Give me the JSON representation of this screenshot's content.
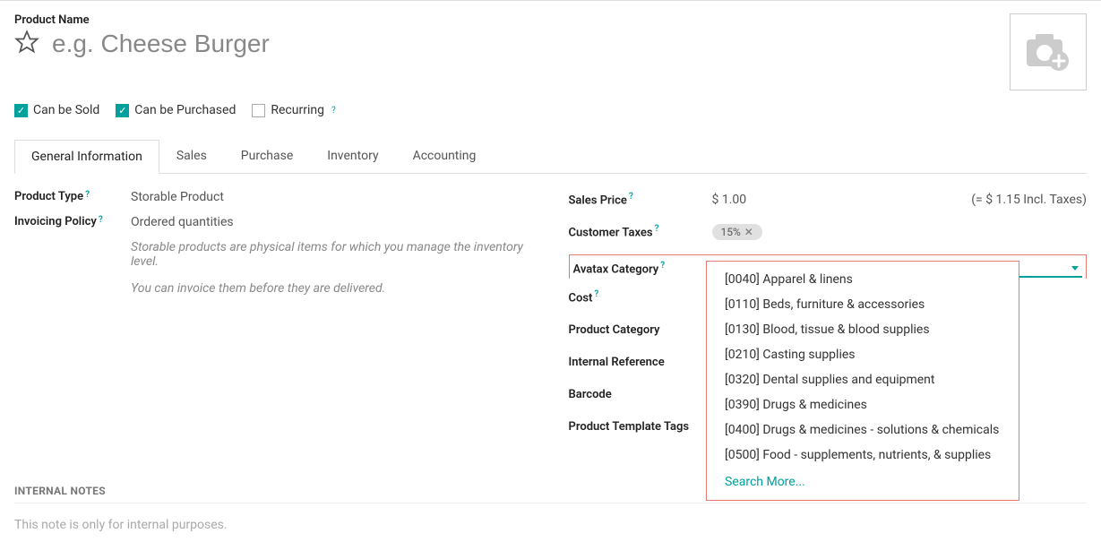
{
  "header": {
    "product_name_label": "Product Name",
    "placeholder": "e.g. Cheese Burger"
  },
  "checks": {
    "sold": "Can be Sold",
    "purchased": "Can be Purchased",
    "recurring": "Recurring"
  },
  "tabs": {
    "general": "General Information",
    "sales": "Sales",
    "purchase": "Purchase",
    "inventory": "Inventory",
    "accounting": "Accounting"
  },
  "left": {
    "product_type_label": "Product Type",
    "product_type_value": "Storable Product",
    "invoicing_label": "Invoicing Policy",
    "invoicing_value": "Ordered quantities",
    "desc1": "Storable products are physical items for which you manage the inventory level.",
    "desc2": "You can invoice them before they are delivered."
  },
  "right": {
    "sales_price_label": "Sales Price",
    "sales_price_value": "$ 1.00",
    "incl_taxes": "(= $ 1.15 Incl. Taxes)",
    "customer_taxes_label": "Customer Taxes",
    "tax_pill": "15%",
    "avatax_label": "Avatax Category",
    "cost_label": "Cost",
    "product_category_label": "Product Category",
    "internal_ref_label": "Internal Reference",
    "barcode_label": "Barcode",
    "tags_label": "Product Template Tags"
  },
  "dropdown": {
    "items": [
      "[0040] Apparel & linens",
      "[0110] Beds, furniture & accessories",
      "[0130] Blood, tissue & blood supplies",
      "[0210] Casting supplies",
      "[0320] Dental supplies and equipment",
      "[0390] Drugs & medicines",
      "[0400] Drugs & medicines - solutions & chemicals",
      "[0500] Food - supplements, nutrients, & supplies"
    ],
    "more": "Search More..."
  },
  "notes": {
    "heading": "INTERNAL NOTES",
    "placeholder": "This note is only for internal purposes."
  }
}
